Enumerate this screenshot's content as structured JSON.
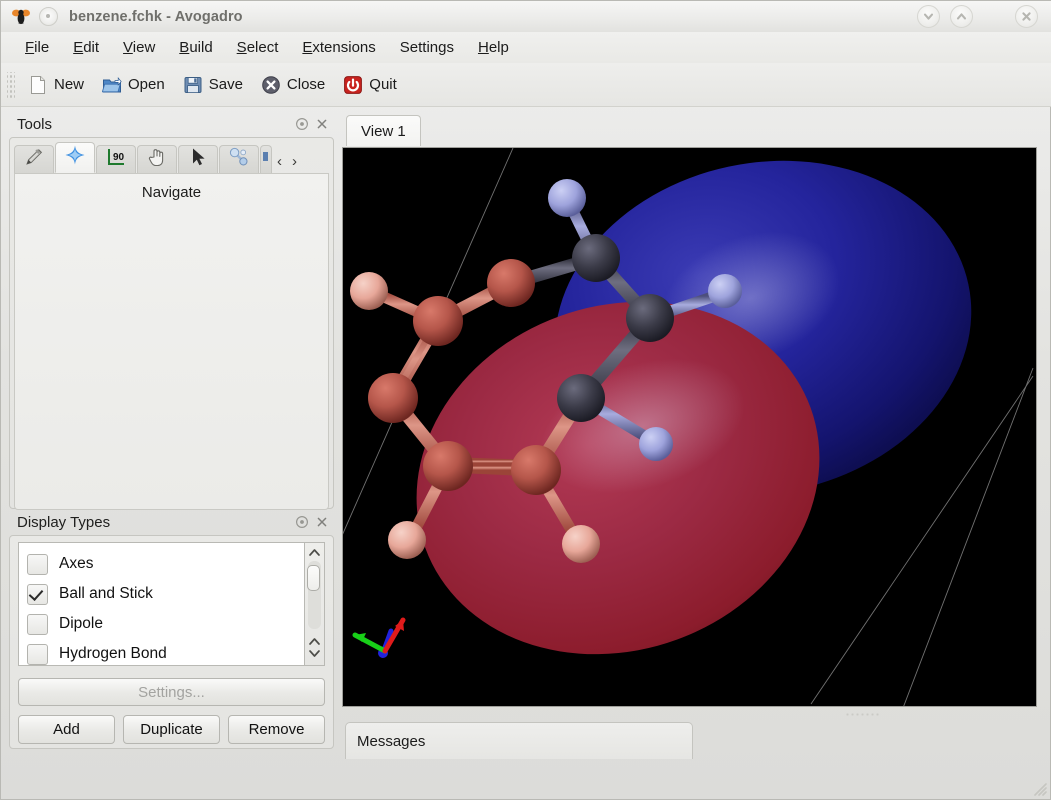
{
  "window": {
    "title": "benzene.fchk - Avogadro",
    "app_logo_icon": "avogadro-logo-icon",
    "doc_icon": "document-icon",
    "buttons": [
      {
        "name": "minimize-button",
        "icon": "chevron-down-icon"
      },
      {
        "name": "maximize-button",
        "icon": "chevron-up-icon"
      },
      {
        "name": "close-button",
        "icon": "close-x-icon"
      }
    ]
  },
  "menubar": {
    "items": [
      {
        "label": "File",
        "mnemonic": "F"
      },
      {
        "label": "Edit",
        "mnemonic": "E"
      },
      {
        "label": "View",
        "mnemonic": "V"
      },
      {
        "label": "Build",
        "mnemonic": "B"
      },
      {
        "label": "Select",
        "mnemonic": "S"
      },
      {
        "label": "Extensions",
        "mnemonic": "E"
      },
      {
        "label": "Settings",
        "mnemonic": ""
      },
      {
        "label": "Help",
        "mnemonic": "H"
      }
    ]
  },
  "toolbar": {
    "items": [
      {
        "label": "New",
        "icon": "new-document-icon"
      },
      {
        "label": "Open",
        "icon": "open-folder-icon"
      },
      {
        "label": "Save",
        "icon": "floppy-disk-icon"
      },
      {
        "label": "Close",
        "icon": "close-circle-icon"
      },
      {
        "label": "Quit",
        "icon": "power-button-icon"
      }
    ]
  },
  "tools_panel": {
    "title": "Tools",
    "float_icon": "undock-icon",
    "close_icon": "close-x-icon",
    "active_tool": "Navigate",
    "tool_tabs": [
      {
        "name": "draw-tool",
        "icon": "pencil-icon",
        "active": false
      },
      {
        "name": "navigate-tool",
        "icon": "navigate-star-icon",
        "active": true
      },
      {
        "name": "measure-tool",
        "icon": "angle-90-icon",
        "active": false
      },
      {
        "name": "manipulate-tool",
        "icon": "pointing-hand-icon",
        "active": false
      },
      {
        "name": "select-tool",
        "icon": "arrow-cursor-icon",
        "active": false
      },
      {
        "name": "bond-centric-tool",
        "icon": "bond-molecule-icon",
        "active": false
      },
      {
        "name": "overflow-tool",
        "icon": "partial-tool-icon",
        "active": false
      }
    ],
    "scroll_prev": "‹",
    "scroll_next": "›"
  },
  "display_types_panel": {
    "title": "Display Types",
    "float_icon": "undock-icon",
    "close_icon": "close-x-icon",
    "items": [
      {
        "label": "Axes",
        "checked": false
      },
      {
        "label": "Ball and Stick",
        "checked": true
      },
      {
        "label": "Dipole",
        "checked": false
      },
      {
        "label": "Hydrogen Bond",
        "checked": false
      }
    ],
    "settings_button": "Settings...",
    "settings_disabled": true,
    "buttons": [
      "Add",
      "Duplicate",
      "Remove"
    ]
  },
  "view": {
    "tab_label": "View 1",
    "background_color": "#000000",
    "orbital": {
      "positive_lobe_color": "#1b1b8e",
      "negative_lobe_color": "#a8203a",
      "carbon_color": "#3a3a46",
      "hydrogen_color": "#9fa3d8",
      "carbon_color_red": "#b5564a",
      "hydrogen_color_red": "#e8a699"
    },
    "axis_indicator": {
      "x_color": "#e01b1b",
      "y_color": "#18d018",
      "z_color": "#2222dd"
    }
  },
  "messages_panel": {
    "tab_label": "Messages"
  },
  "statusbar": {
    "resize_grip_icon": "resize-grip-icon"
  }
}
